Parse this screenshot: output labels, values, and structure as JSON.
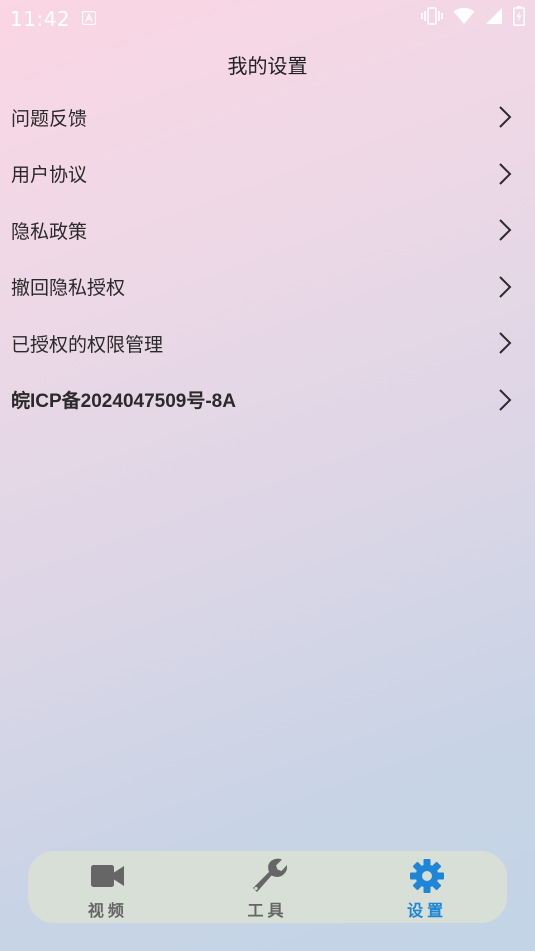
{
  "status_bar": {
    "time": "11:42",
    "icons": [
      "a-notification-icon",
      "vibrate-icon",
      "wifi-icon",
      "signal-icon",
      "battery-charging-icon"
    ]
  },
  "header": {
    "title": "我的设置"
  },
  "menu": {
    "items": [
      {
        "label": "问题反馈"
      },
      {
        "label": "用户协议"
      },
      {
        "label": "隐私政策"
      },
      {
        "label": "撤回隐私授权"
      },
      {
        "label": "已授权的权限管理"
      },
      {
        "label": "皖ICP备2024047509号-8A"
      }
    ],
    "chevron_icon": "chevron-right-icon"
  },
  "bottom_nav": {
    "items": [
      {
        "label": "视频",
        "icon": "video-camera-icon",
        "active": false
      },
      {
        "label": "工具",
        "icon": "wrench-icon",
        "active": false
      },
      {
        "label": "设置",
        "icon": "gear-icon",
        "active": true
      }
    ]
  },
  "colors": {
    "accent": "#1e86d6",
    "inactive": "#666666",
    "nav_background": "#d7dfd6",
    "gradient_start": "#fbd6e4",
    "gradient_end": "#c2d4e6"
  }
}
